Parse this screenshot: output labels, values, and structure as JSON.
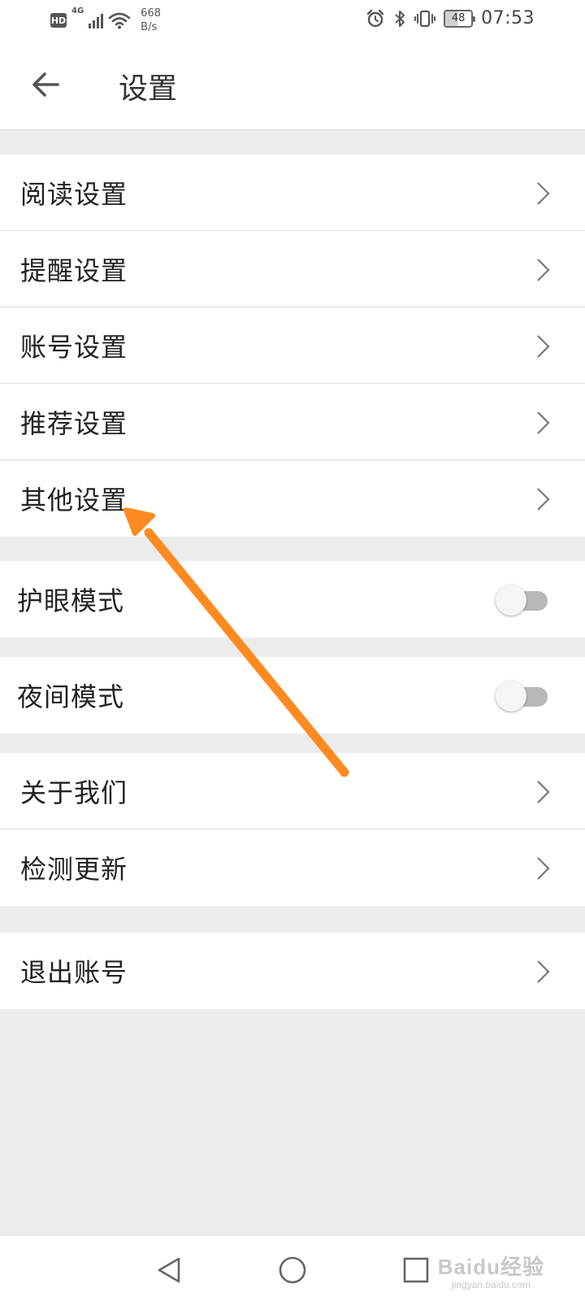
{
  "status_bar": {
    "hd": "HD",
    "network": "4G",
    "speed_value": "668",
    "speed_unit": "B/s",
    "battery": "48",
    "time": "07:53"
  },
  "header": {
    "title": "设置",
    "back_icon": "back-arrow-icon"
  },
  "groups": [
    {
      "items": [
        {
          "label": "阅读设置",
          "control": "chevron"
        },
        {
          "label": "提醒设置",
          "control": "chevron"
        },
        {
          "label": "账号设置",
          "control": "chevron"
        },
        {
          "label": "推荐设置",
          "control": "chevron"
        },
        {
          "label": "其他设置",
          "control": "chevron"
        }
      ]
    },
    {
      "items": [
        {
          "label": "护眼模式",
          "control": "toggle",
          "on": false
        }
      ]
    },
    {
      "items": [
        {
          "label": "夜间模式",
          "control": "toggle",
          "on": false
        }
      ]
    },
    {
      "items": [
        {
          "label": "关于我们",
          "control": "chevron"
        },
        {
          "label": "检测更新",
          "control": "chevron"
        }
      ]
    },
    {
      "items": [
        {
          "label": "退出账号",
          "control": "chevron"
        }
      ]
    }
  ],
  "annotation": {
    "color": "#ff8a1f",
    "points_to": "其他设置"
  },
  "nav_bar": {
    "back": "triangle-back-icon",
    "home": "circle-home-icon",
    "recents": "square-recents-icon"
  },
  "watermark": {
    "main": "Baidu经验",
    "sub": "jingyan.baidu.com"
  }
}
